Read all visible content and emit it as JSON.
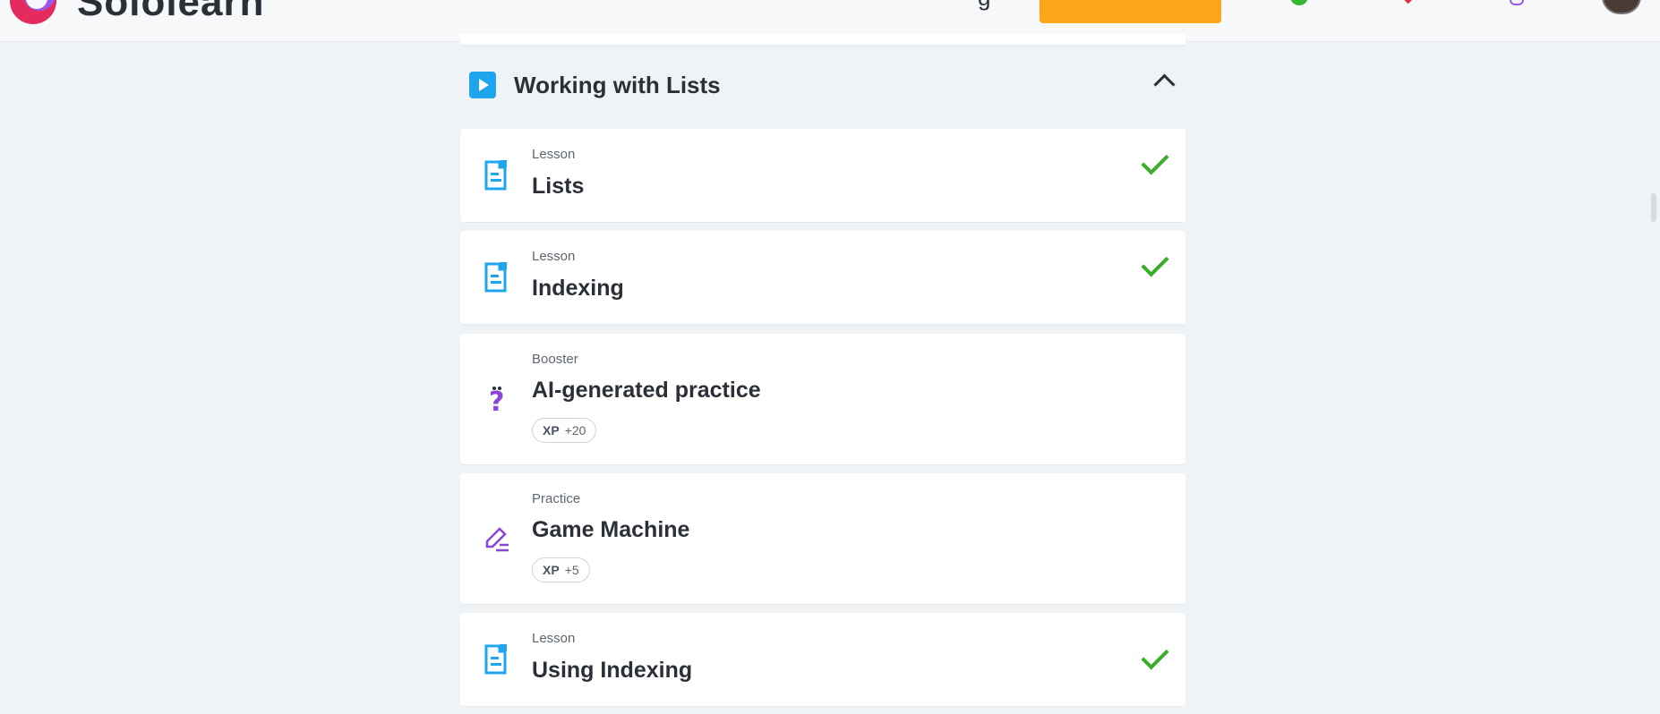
{
  "header": {
    "logo_text": "Sololearn",
    "nav_fragment": "g"
  },
  "section": {
    "title": "Working with Lists"
  },
  "items": [
    {
      "type": "Lesson",
      "title": "Lists",
      "completed": true,
      "icon": "lesson-doc-icon"
    },
    {
      "type": "Lesson",
      "title": "Indexing",
      "completed": true,
      "icon": "lesson-doc-icon"
    },
    {
      "type": "Booster",
      "title": "AI-generated practice",
      "completed": false,
      "icon": "question-mark-icon",
      "xp_label": "XP",
      "xp_value": "+20"
    },
    {
      "type": "Practice",
      "title": "Game Machine",
      "completed": false,
      "icon": "pencil-lines-icon",
      "xp_label": "XP",
      "xp_value": "+5"
    },
    {
      "type": "Lesson",
      "title": "Using Indexing",
      "completed": true,
      "icon": "lesson-doc-icon"
    }
  ],
  "colors": {
    "accent_blue": "#1fa5ed",
    "cta_orange": "#ffa51a",
    "check_green": "#3aad2a",
    "practice_purple": "#8a44d8"
  }
}
